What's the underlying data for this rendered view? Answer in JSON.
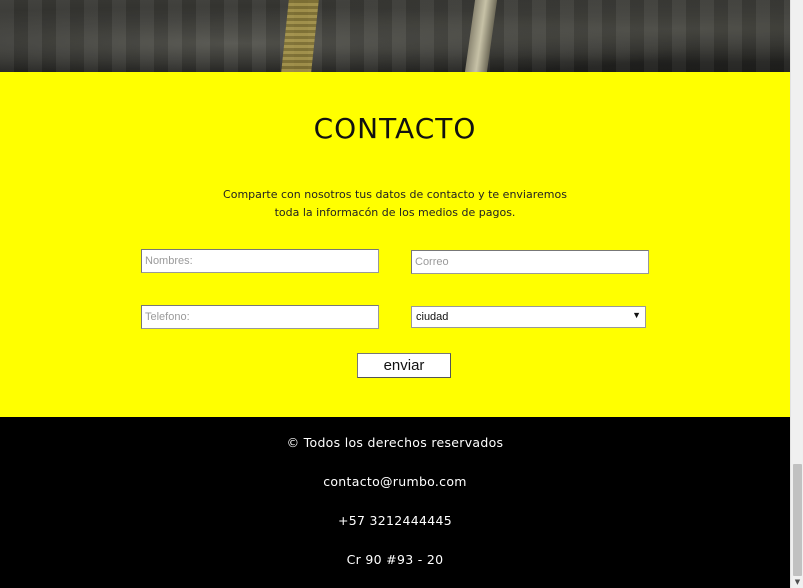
{
  "contact": {
    "title": "CONTACTO",
    "description_line1": "Comparte con nosotros tus datos de contacto y te enviaremos",
    "description_line2": "toda la informacón de los medios de pagos.",
    "fields": {
      "nombres_placeholder": "Nombres:",
      "correo_placeholder": "Correo",
      "telefono_placeholder": "Telefono:",
      "ciudad_selected": "ciudad"
    },
    "submit_label": "enviar"
  },
  "footer": {
    "copyright": "© Todos los derechos reservados",
    "email": "contacto@rumbo.com",
    "phone": "+57 3212444445",
    "address": "Cr 90 #93 - 20"
  },
  "icons": {
    "select_arrow": "caret-down-icon",
    "scroll_down": "scroll-down-arrow-icon"
  },
  "colors": {
    "contact_bg": "#ffff00",
    "footer_bg": "#000000"
  }
}
